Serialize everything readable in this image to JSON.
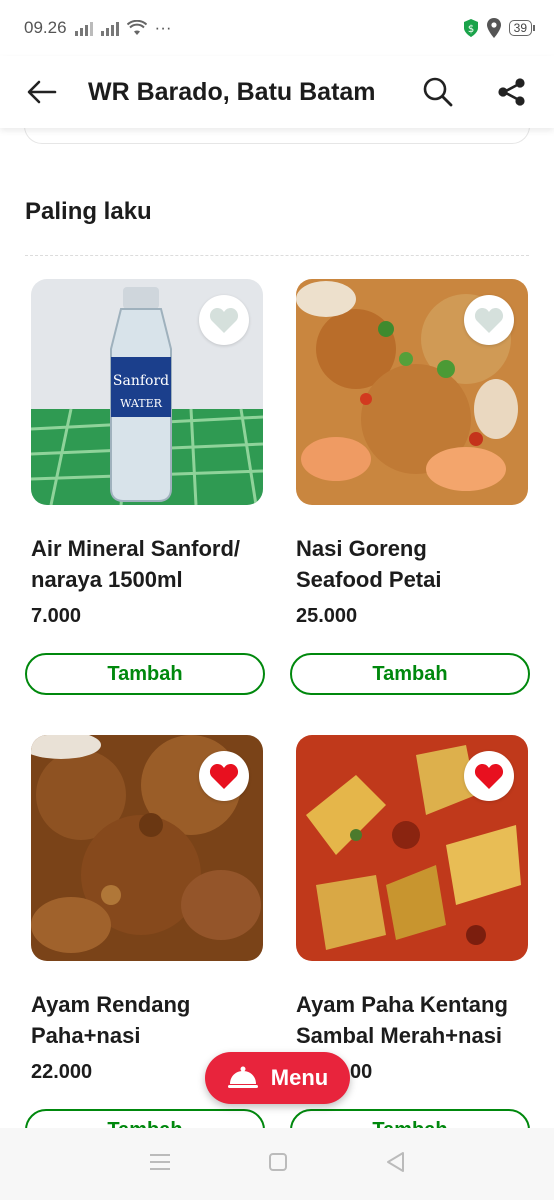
{
  "status": {
    "time": "09.26",
    "dots": "···",
    "battery": "39"
  },
  "header": {
    "title": "WR Barado, Batu Batam"
  },
  "section": {
    "title": "Paling laku"
  },
  "products": [
    {
      "name_line1": "Air Mineral Sanford/",
      "name_line2": "naraya 1500ml",
      "price": "7.000",
      "button": "Tambah",
      "favorited": false
    },
    {
      "name_line1": "Nasi Goreng",
      "name_line2": "Seafood Petai",
      "price": "25.000",
      "button": "Tambah",
      "favorited": false
    },
    {
      "name_line1": "Ayam Rendang",
      "name_line2": "Paha+nasi",
      "price": "22.000",
      "button": "Tambah",
      "favorited": true
    },
    {
      "name_line1": "Ayam Paha Kentang",
      "name_line2": "Sambal Merah+nasi",
      "price": "00",
      "button": "Tambah",
      "favorited": true
    }
  ],
  "menu_button": {
    "label": "Menu"
  },
  "colors": {
    "accent_green": "#00880d",
    "menu_red": "#e8243c",
    "heart_red": "#e8101f",
    "heart_grey": "#d5e0dc"
  },
  "icons": {
    "back": "arrow-left-icon",
    "search": "search-icon",
    "share": "share-icon",
    "favorite": "heart-icon",
    "menu": "cloche-icon"
  }
}
